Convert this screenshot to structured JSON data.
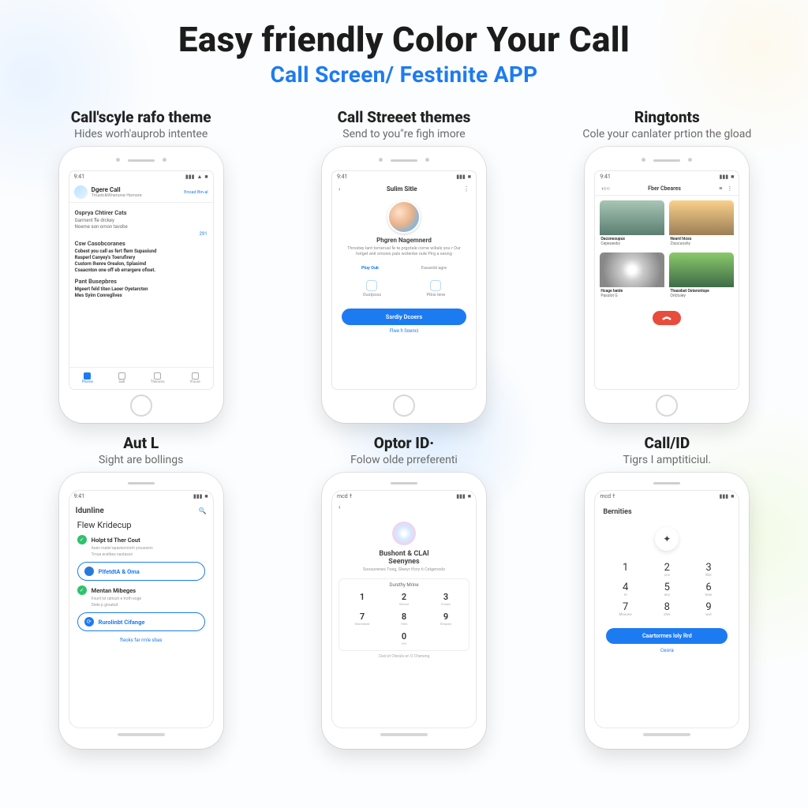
{
  "header": {
    "title": "Easy friendly Color Your Call",
    "subtitle": "Call Screen/ Festinite APP"
  },
  "features": [
    {
      "title": "Call'scyle rafo theme",
      "sub": "Hides worh'auprob intentee"
    },
    {
      "title": "Call Streeet themes",
      "sub": "Send to you\"re figh imore"
    },
    {
      "title": "Ringtonts",
      "sub": "Cole your canlater prtion the gload"
    },
    {
      "title": "Aut L",
      "sub": "Sight are bollings"
    },
    {
      "title": "Optor ID·",
      "sub": "Folow olde prreferenti"
    },
    {
      "title": "Call/ID",
      "sub": "Tigrs I amptiticiul."
    }
  ],
  "status": {
    "left_a": "9:41",
    "left_b": "mcd †",
    "signal": "▮▮▮",
    "wifi": "▲",
    "batt": "■"
  },
  "p1": {
    "brand": "Dgere Call",
    "brand_sub": "Tmadc&Wnenone Hsmore",
    "right_link": "Enoad Bin-al",
    "s1": "Osprya Chtirer Cats",
    "s1_a": "Garment fle drckey",
    "s1_b": "Noeme son omon tavobe",
    "s2": "Csw Casobcoranes",
    "li1": "Cobest you call as fert flem Supasiund",
    "li2": "Rasperl Canyey's Toerufirery",
    "li3": "Custorn Ihenre Orealon, Splasimd",
    "li4": "Csaacnton one off eb errargere ofiset.",
    "s3": "Pant Busepbres",
    "li5": "Mgeert feld titen Laoer Oyetarcton",
    "li6": "Mes Syim Conreglives",
    "tabs": [
      "Phome",
      "Gall",
      "Theroms",
      "Yroure"
    ]
  },
  "p2": {
    "back": "‹",
    "title": "Sulim Sitle",
    "more": "⋮",
    "name": "Phgren Nagemnerd",
    "desc": "Throstey lant tsmerual fe te prgotale come wilials you r Our holget anil smows pals wolenbe oule Pirg a seong",
    "a1": "Pluy Ouk",
    "a2": "Easardd agre",
    "i1": "Oustposs",
    "i2": "Pibis lene",
    "cta": "Ssrdiy Dcoers",
    "link": "Flwe h Soenci"
  },
  "p3": {
    "back": "‹○○",
    "title": "Fber Cbeares",
    "menu": "≡",
    "more": "⋮",
    "c1a": "Oaconesupus",
    "c1b": "Cepeuesby",
    "c2a": "Neard htces",
    "c2b": "Zisocuoshy",
    "c3a": "Hcage baide",
    "c3b": "Passlot G",
    "c4a": "Thassbat Ostaronlope",
    "c4b": "Orlctuiey"
  },
  "p4": {
    "title": "Idunline",
    "search": "🔍",
    "h": "Flew Kridecup",
    "t1": "Holpt td Ther Cout",
    "s1": "Asen matel epaveomiorh yrouswon",
    "s1b": "Tmua ecelbes nastassn",
    "b1": "PlfetdtA & Oma",
    "t2": "Mentan Mibeges",
    "s2": "Founl lst ratiosh e troth eoge",
    "s2b": "Stele p groatod",
    "b2": "Rurolinbt Cifange",
    "link": "fteoks far rmle sbas"
  },
  "p5": {
    "back": "‹",
    "t1": "Bushont & CLAl",
    "t2": "Seenynes",
    "sub": "Soosurenes Toeg, Sleeyr tfory ti Celgenods",
    "kbtitle": "Dursthy Mrine",
    "k": [
      [
        "1",
        ""
      ],
      [
        "2",
        "Citenre"
      ],
      [
        "3",
        "Fhswe"
      ],
      [
        "7",
        "Wonsteast"
      ],
      [
        "8",
        "Thes"
      ],
      [
        "9",
        "Rotqdor"
      ],
      [
        "",
        "0",
        ""
      ],
      [
        "0",
        "Fet"
      ],
      [
        "",
        "",
        ""
      ]
    ],
    "bottom": "Cied et Oterals en O Cheneng"
  },
  "p6": {
    "title": "Bernities",
    "icon": "✦",
    "k": [
      [
        "1",
        ""
      ],
      [
        "2",
        "cce"
      ],
      [
        "3",
        "Wor"
      ],
      [
        "4",
        "re"
      ],
      [
        "5",
        "anu"
      ],
      [
        "6",
        "teas"
      ],
      [
        "7",
        "Msoone"
      ],
      [
        "8",
        "sfes"
      ],
      [
        "9",
        "wot"
      ]
    ],
    "btn": "Caartorrnes loly Rrd",
    "link": "Ceora"
  }
}
